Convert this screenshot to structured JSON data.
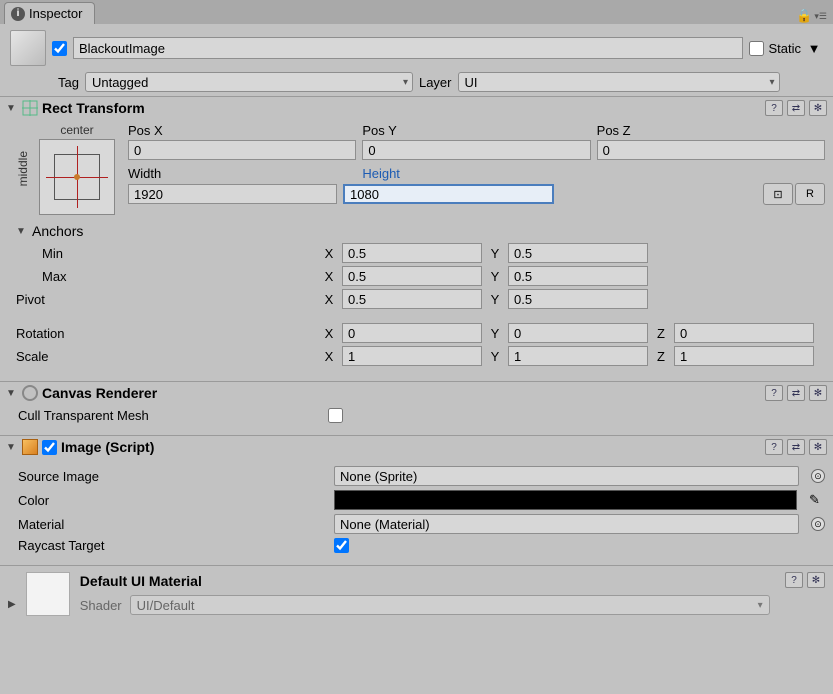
{
  "tab": {
    "title": "Inspector",
    "lock_icon": "lock"
  },
  "header": {
    "active": true,
    "name": "BlackoutImage",
    "static_label": "Static",
    "static_checked": false,
    "tag_label": "Tag",
    "tag_value": "Untagged",
    "layer_label": "Layer",
    "layer_value": "UI"
  },
  "rect_transform": {
    "title": "Rect Transform",
    "anchor_horiz": "center",
    "anchor_vert": "middle",
    "labels": {
      "posx": "Pos X",
      "posy": "Pos Y",
      "posz": "Pos Z",
      "width": "Width",
      "height": "Height"
    },
    "pos": {
      "x": "0",
      "y": "0",
      "z": "0"
    },
    "size": {
      "width": "1920",
      "height": "1080"
    },
    "blueprint_btn": "⊡",
    "raw_btn": "R",
    "anchors_label": "Anchors",
    "anchors": {
      "min_label": "Min",
      "min": {
        "x": "0.5",
        "y": "0.5"
      },
      "max_label": "Max",
      "max": {
        "x": "0.5",
        "y": "0.5"
      }
    },
    "pivot_label": "Pivot",
    "pivot": {
      "x": "0.5",
      "y": "0.5"
    },
    "rotation_label": "Rotation",
    "rotation": {
      "x": "0",
      "y": "0",
      "z": "0"
    },
    "scale_label": "Scale",
    "scale": {
      "x": "1",
      "y": "1",
      "z": "1"
    },
    "axis": {
      "x": "X",
      "y": "Y",
      "z": "Z"
    }
  },
  "canvas_renderer": {
    "title": "Canvas Renderer",
    "cull_label": "Cull Transparent Mesh",
    "cull_value": false
  },
  "image": {
    "title": "Image (Script)",
    "enabled": true,
    "source_label": "Source Image",
    "source_value": "None (Sprite)",
    "color_label": "Color",
    "color_value": "#000000",
    "material_label": "Material",
    "material_value": "None (Material)",
    "raycast_label": "Raycast Target",
    "raycast_value": true
  },
  "material": {
    "title": "Default UI Material",
    "shader_label": "Shader",
    "shader_value": "UI/Default"
  }
}
